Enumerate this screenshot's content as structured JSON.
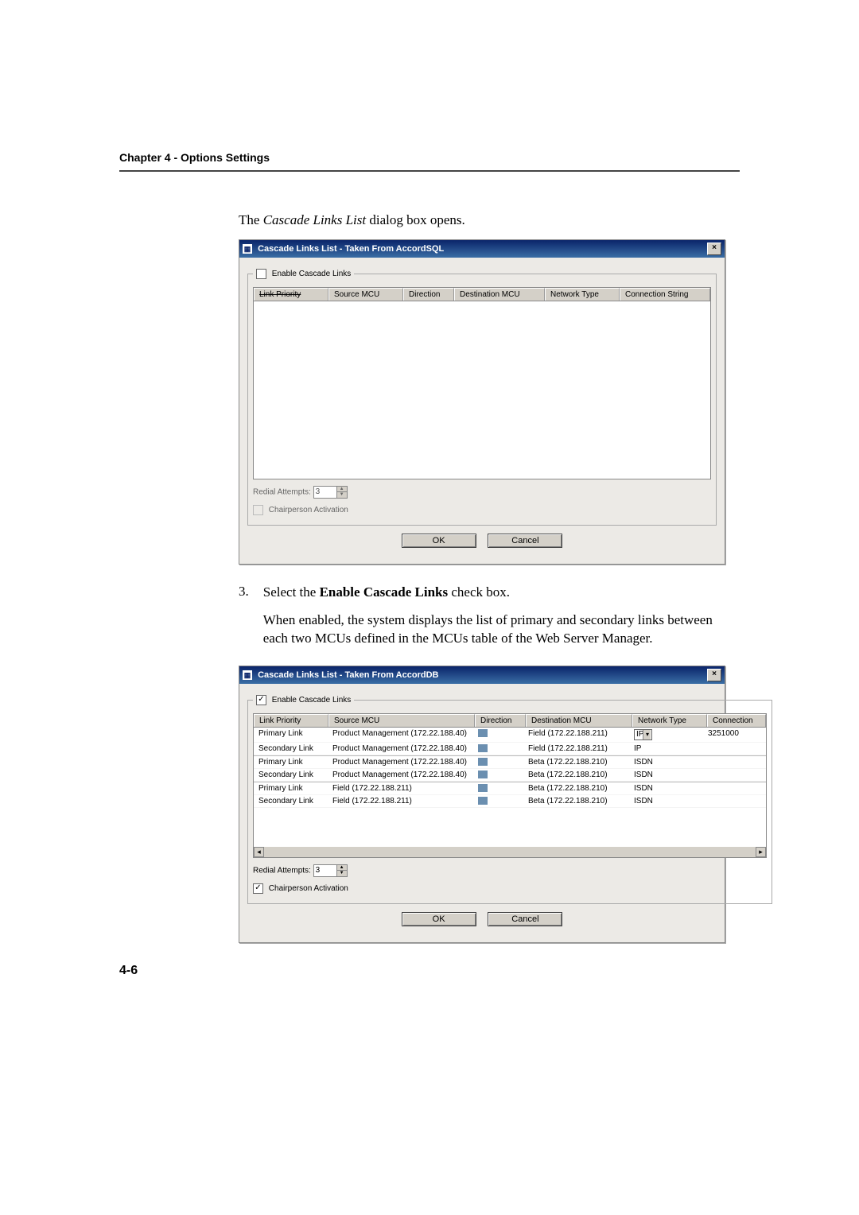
{
  "chapter_header": "Chapter 4 - Options Settings",
  "intro_open": "The ",
  "intro_italic": "Cascade Links List",
  "intro_close": " dialog box opens.",
  "step_number": "3.",
  "step_open": "Select the ",
  "step_bold": "Enable Cascade Links",
  "step_close": " check box.",
  "step_para2": "When enabled, the system displays the list of primary and secondary links between each two MCUs defined in the MCUs table of the Web Server Manager.",
  "page_number": "4-6",
  "dialog1": {
    "title": "Cascade Links List - Taken From AccordSQL",
    "checkbox_checked": false,
    "checkbox_label": "Enable Cascade Links",
    "columns": {
      "link_priority": "Link Priority",
      "source_mcu": "Source MCU",
      "direction": "Direction",
      "destination_mcu": "Destination MCU",
      "network_type": "Network Type",
      "connection_string": "Connection String"
    },
    "redial_label": "Redial Attempts:",
    "redial_value": "3",
    "chairperson_label": "Chairperson Activation",
    "chairperson_checked": false,
    "ok": "OK",
    "cancel": "Cancel"
  },
  "dialog2": {
    "title": "Cascade Links List - Taken From AccordDB",
    "checkbox_checked": true,
    "checkbox_label": "Enable Cascade Links",
    "columns": {
      "link_priority": "Link Priority",
      "source_mcu": "Source MCU",
      "direction": "Direction",
      "destination_mcu": "Destination MCU",
      "network_type": "Network Type",
      "connection": "Connection"
    },
    "rows": [
      {
        "priority": "Primary Link",
        "source": "Product Management (172.22.188.40)",
        "dest": "Field (172.22.188.211)",
        "net": "IP",
        "conn": "3251000",
        "ip_select": true
      },
      {
        "priority": "Secondary Link",
        "source": "Product Management (172.22.188.40)",
        "dest": "Field (172.22.188.211)",
        "net": "IP",
        "conn": ""
      },
      {
        "priority": "Primary Link",
        "source": "Product Management (172.22.188.40)",
        "dest": "Beta (172.22.188.210)",
        "net": "ISDN",
        "conn": ""
      },
      {
        "priority": "Secondary Link",
        "source": "Product Management (172.22.188.40)",
        "dest": "Beta (172.22.188.210)",
        "net": "ISDN",
        "conn": ""
      },
      {
        "priority": "Primary Link",
        "source": "Field (172.22.188.211)",
        "dest": "Beta (172.22.188.210)",
        "net": "ISDN",
        "conn": ""
      },
      {
        "priority": "Secondary Link",
        "source": "Field (172.22.188.211)",
        "dest": "Beta (172.22.188.210)",
        "net": "ISDN",
        "conn": ""
      }
    ],
    "redial_label": "Redial Attempts:",
    "redial_value": "3",
    "chairperson_label": "Chairperson Activation",
    "chairperson_checked": true,
    "ok": "OK",
    "cancel": "Cancel"
  }
}
